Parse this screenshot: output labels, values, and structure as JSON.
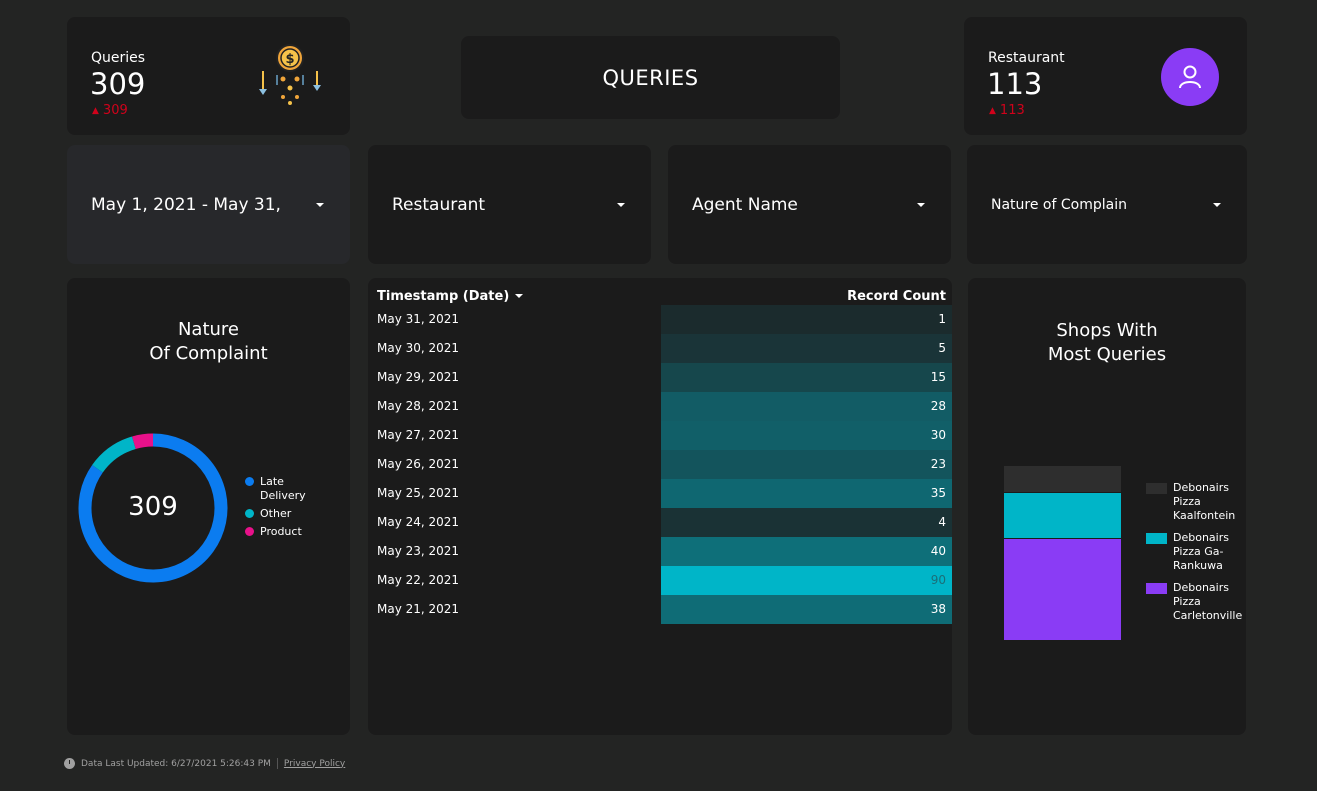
{
  "kpis": {
    "queries": {
      "label": "Queries",
      "value": "309",
      "delta": "309",
      "icon": "money-bag-icon"
    },
    "restaurant": {
      "label": "Restaurant",
      "value": "113",
      "delta": "113",
      "icon": "user-icon"
    }
  },
  "title": "QUERIES",
  "filters": {
    "date": "May 1, 2021 - May 31,",
    "restaurant": "Restaurant",
    "agent": "Agent Name",
    "complain": "Nature of Complain"
  },
  "donut": {
    "title_line1": "Nature",
    "title_line2": "Of Complaint",
    "total": "309",
    "legend": [
      {
        "label": "Late Delivery",
        "color": "#0b7cf0"
      },
      {
        "label": "Other",
        "color": "#00b5c8"
      },
      {
        "label": "Product",
        "color": "#e8118a"
      }
    ]
  },
  "table": {
    "col_date": "Timestamp (Date)",
    "col_count": "Record Count",
    "rows": [
      {
        "date": "May 31, 2021",
        "count": "1"
      },
      {
        "date": "May 30, 2021",
        "count": "5"
      },
      {
        "date": "May 29, 2021",
        "count": "15"
      },
      {
        "date": "May 28, 2021",
        "count": "28"
      },
      {
        "date": "May 27, 2021",
        "count": "30"
      },
      {
        "date": "May 26, 2021",
        "count": "23"
      },
      {
        "date": "May 25, 2021",
        "count": "35"
      },
      {
        "date": "May 24, 2021",
        "count": "4"
      },
      {
        "date": "May 23, 2021",
        "count": "40"
      },
      {
        "date": "May 22, 2021",
        "count": "90"
      },
      {
        "date": "May 21, 2021",
        "count": "38"
      }
    ]
  },
  "shops": {
    "title_line1": "Shops With",
    "title_line2": "Most Queries",
    "legend": [
      {
        "label": "Debonairs Pizza Kaalfontein",
        "color": "#2e2e2e"
      },
      {
        "label": "Debonairs Pizza Ga-Rankuwa",
        "color": "#00b5c8"
      },
      {
        "label": "Debonairs Pizza Carletonville",
        "color": "#8a3cf5"
      }
    ]
  },
  "chart_data": [
    {
      "type": "pie",
      "categories": [
        "Late Delivery",
        "Other",
        "Product"
      ],
      "values": [
        262,
        33,
        14
      ],
      "title": "Nature Of Complaint"
    },
    {
      "type": "bar",
      "stacked": true,
      "title": "Shops With Most Queries",
      "series": [
        {
          "name": "Debonairs Pizza Kaalfontein",
          "values": [
            27
          ]
        },
        {
          "name": "Debonairs Pizza Ga-Rankuwa",
          "values": [
            46
          ]
        },
        {
          "name": "Debonairs Pizza Carletonville",
          "values": [
            101
          ]
        }
      ]
    }
  ],
  "footer": {
    "updated": "Data Last Updated: 6/27/2021 5:26:43 PM",
    "privacy": "Privacy Policy"
  }
}
